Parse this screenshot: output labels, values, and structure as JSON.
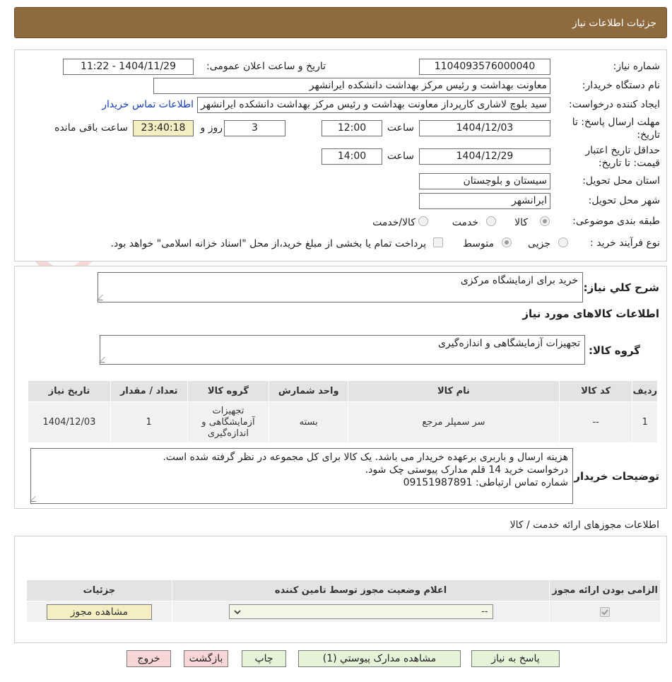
{
  "header": {
    "title": "جزئیات اطلاعات نیاز"
  },
  "watermark": {
    "brand": "AriaTender.net"
  },
  "details": {
    "need_number_label": "شماره نیاز:",
    "need_number": "1104093576000040",
    "announce_label": "تاریخ و ساعت اعلان عمومی:",
    "announce_value": "1404/11/29 - 11:22",
    "buyer_org_label": "نام دستگاه خریدار:",
    "buyer_org": "معاونت بهداشت و رئیس مرکز بهداشت دانشکده ایرانشهر",
    "requester_label": "ایجاد کننده درخواست:",
    "requester": "سید بلوچ لاشاری کارپرداز معاونت بهداشت و رئیس مرکز بهداشت دانشکده ایرانشهر",
    "contact_link": "اطلاعات تماس خریدار",
    "deadline_label_1": "مهلت ارسال پاسخ: تا",
    "deadline_label_2": "تاریخ:",
    "deadline_date": "1404/12/03",
    "time_label": "ساعت",
    "deadline_time": "12:00",
    "days_value": "3",
    "days_label": "روز و",
    "remaining_time": "23:40:18",
    "remaining_label": "ساعت باقی مانده",
    "validity_label_1": "حداقل تاریخ اعتبار",
    "validity_label_2": "قیمت: تا تاریخ:",
    "validity_date": "1404/12/29",
    "validity_time": "14:00",
    "province_label": "استان محل تحویل:",
    "province": "سیستان و بلوچستان",
    "city_label": "شهر محل تحویل:",
    "city": "ایرانشهر",
    "category_label": "طبقه بندی موضوعی:",
    "category_options": [
      "کالا",
      "خدمت",
      "کالا/خدمت"
    ],
    "process_label": "نوع فرآیند خرید :",
    "process_options": [
      "جزیی",
      "متوسط"
    ],
    "payment_note": "پرداخت تمام یا بخشی از مبلغ خرید،از محل \"اسناد خزانه اسلامی\" خواهد بود."
  },
  "summary": {
    "desc_label": "شرح کلي نياز:",
    "desc_value": "خرید برای ازمایشگاه مرکزی",
    "goods_title": "اطلاعات کالاهای مورد نیاز",
    "group_label": "گروه کالا:",
    "group_value": "تجهیزات آزمایشگاهی و اندازه‌گیری"
  },
  "goods_table": {
    "headers": [
      "ردیف",
      "کد کالا",
      "نام کالا",
      "واحد شمارش",
      "گروه کالا",
      "تعداد / مقدار",
      "تاریخ نیاز"
    ],
    "rows": [
      {
        "row": "1",
        "code": "--",
        "name": "سر سمپلر مرجع",
        "unit": "بسته",
        "group": "تجهیزات آزمایشگاهی و اندازه‌گیری",
        "qty": "1",
        "date": "1404/12/03"
      }
    ]
  },
  "buyer_notes": {
    "label": "توضیحات خریدار:",
    "line1": "هزینه ارسال و باربری برعهده خریدار می باشد. یک کالا برای کل مجموعه در نظر گرفته شده است.",
    "line2": "درخواست خرید 14 قلم مدارک پیوستی چک شود.",
    "line3": "شماره تماس ارتباطی: 09151987891"
  },
  "permits": {
    "title": "اطلاعات مجوزهای ارائه خدمت / کالا",
    "headers": [
      "الزامی بودن ارائه مجوز",
      "اعلام وضعیت مجوز توسط تامین کننده",
      "جزئیات"
    ],
    "select_value": "--",
    "view_button": "مشاهده مجوز"
  },
  "actions": {
    "reply": "پاسخ به نیاز",
    "attachments": "مشاهده مدارک پیوستي (1)",
    "print": "چاپ",
    "back": "بازگشت",
    "exit": "خروج"
  },
  "colors": {
    "header_bg": "#8f6a3f",
    "green_btn": "#e5f3d9",
    "pink_btn": "#f9d6d6",
    "yellow_field": "#f4eec2",
    "link": "#1a3fb8"
  }
}
